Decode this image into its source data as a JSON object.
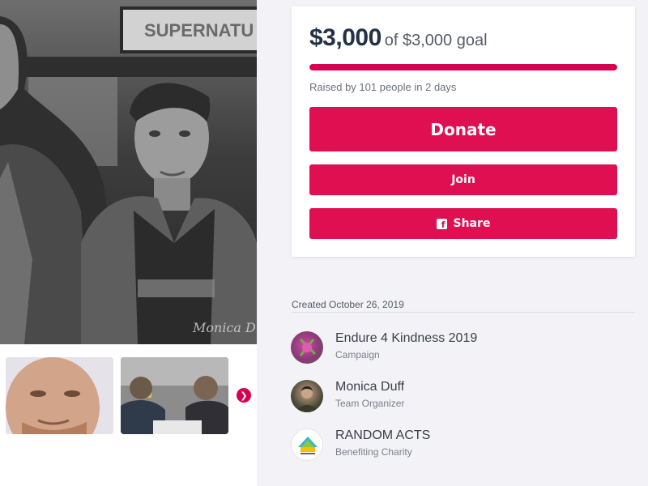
{
  "campaign": {
    "amount_raised": "$3,000",
    "goal_text": "of $3,000 goal",
    "progress_fraction": 1.0,
    "raised_by": "Raised by 101 people in 2 days"
  },
  "buttons": {
    "donate": "Donate",
    "join": "Join",
    "share": "Share"
  },
  "hero": {
    "sign_text": "SUPERNATU",
    "watermark": "Monica D"
  },
  "created": "Created October 26, 2019",
  "entities": [
    {
      "name": "Endure 4 Kindness 2019",
      "role": "Campaign"
    },
    {
      "name": "Monica Duff",
      "role": "Team Organizer"
    },
    {
      "name": "RANDOM ACTS",
      "role": "Benefiting Charity"
    }
  ],
  "colors": {
    "accent": "#df0f52",
    "amount_text": "#233146",
    "page_bg": "#f3f2f7"
  },
  "icons": {
    "share": "facebook-icon",
    "carousel_next": "chevron-right-icon"
  }
}
